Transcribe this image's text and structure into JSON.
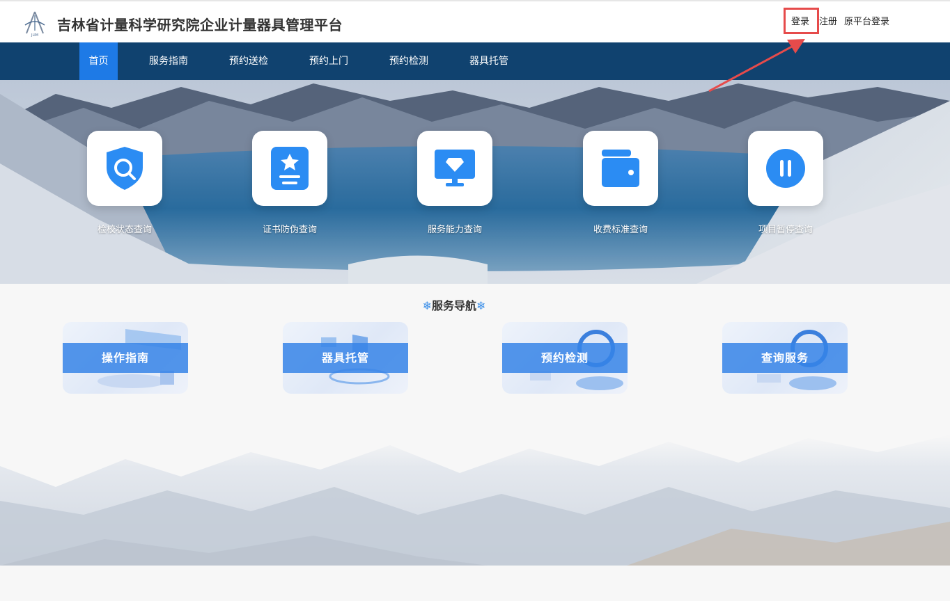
{
  "header": {
    "title": "吉林省计量科学研究院企业计量器具管理平台",
    "login": "登录",
    "register": "注册",
    "old_login": "原平台登录"
  },
  "nav": {
    "items": [
      {
        "label": "首页",
        "active": true
      },
      {
        "label": "服务指南"
      },
      {
        "label": "预约送检"
      },
      {
        "label": "预约上门"
      },
      {
        "label": "预约检测"
      },
      {
        "label": "器具托管"
      }
    ]
  },
  "quick_links": [
    {
      "label": "检校状态查询",
      "icon": "shield-search-icon"
    },
    {
      "label": "证书防伪查询",
      "icon": "certificate-icon"
    },
    {
      "label": "服务能力查询",
      "icon": "monitor-diamond-icon"
    },
    {
      "label": "收费标准查询",
      "icon": "wallet-icon"
    },
    {
      "label": "项目暂停查询",
      "icon": "pause-icon"
    }
  ],
  "service": {
    "flake_left": "❄",
    "title": "服务导航",
    "flake_right": "❄",
    "cards": [
      {
        "label": "操作指南"
      },
      {
        "label": "器具托管"
      },
      {
        "label": "预约检测"
      },
      {
        "label": "查询服务"
      }
    ]
  },
  "colors": {
    "nav_bg": "#10426f",
    "nav_active": "#1e7ae6",
    "icon_blue": "#2b8cf3",
    "highlight_red": "#e64b4b"
  }
}
